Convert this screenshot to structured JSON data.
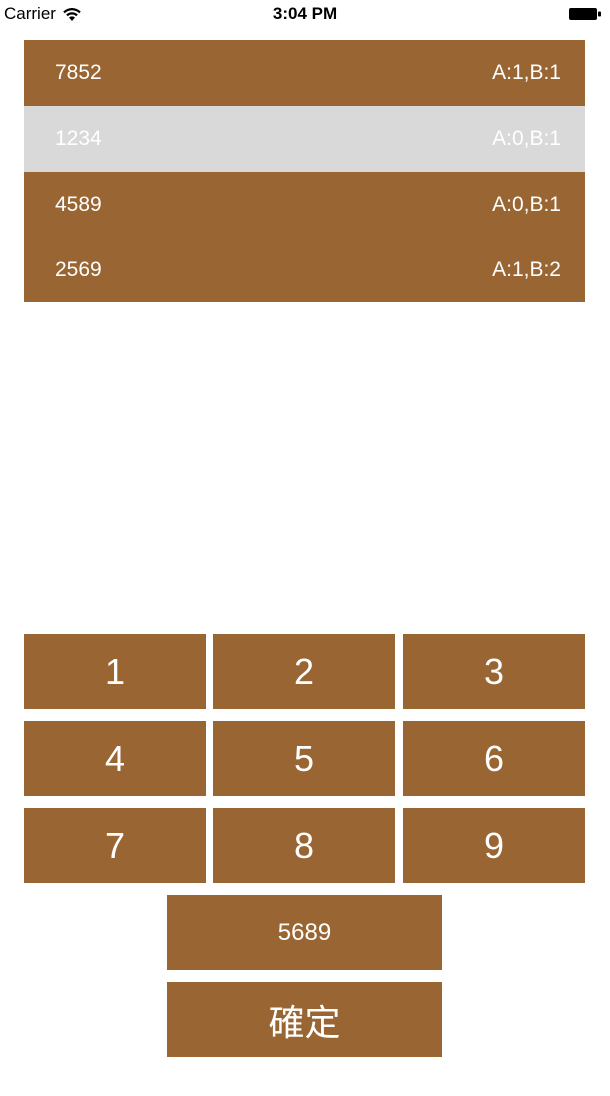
{
  "status_bar": {
    "carrier": "Carrier",
    "time": "3:04 PM"
  },
  "history": [
    {
      "guess": "7852",
      "result": "A:1,B:1",
      "selected": false
    },
    {
      "guess": "1234",
      "result": "A:0,B:1",
      "selected": true
    },
    {
      "guess": "4589",
      "result": "A:0,B:1",
      "selected": false
    },
    {
      "guess": "2569",
      "result": "A:1,B:2",
      "selected": false
    }
  ],
  "keypad": {
    "keys": [
      "1",
      "2",
      "3",
      "4",
      "5",
      "6",
      "7",
      "8",
      "9"
    ]
  },
  "guess_display": "5689",
  "confirm_label": "確定",
  "colors": {
    "accent": "#996633",
    "selected_row": "#d9d9d9",
    "text": "#ffffff"
  }
}
